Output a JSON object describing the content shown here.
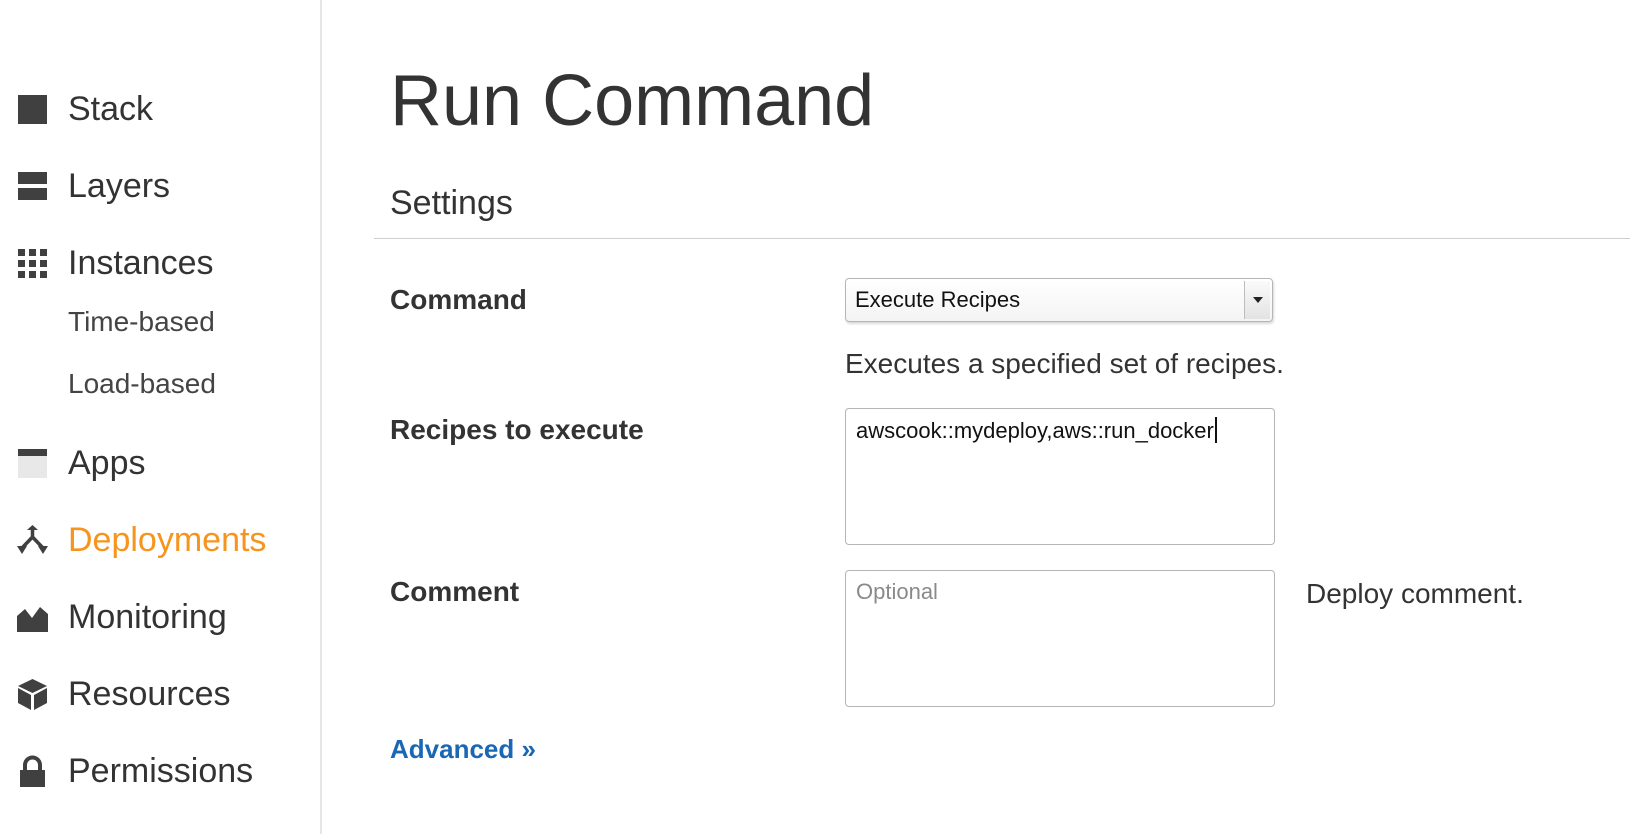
{
  "sidebar": {
    "items": [
      {
        "label": "Stack",
        "icon": "stack-icon"
      },
      {
        "label": "Layers",
        "icon": "layers-icon"
      },
      {
        "label": "Instances",
        "icon": "instances-icon"
      },
      {
        "label": "Apps",
        "icon": "apps-icon"
      },
      {
        "label": "Deployments",
        "icon": "deployments-icon",
        "active": true
      },
      {
        "label": "Monitoring",
        "icon": "monitoring-icon"
      },
      {
        "label": "Resources",
        "icon": "resources-icon"
      },
      {
        "label": "Permissions",
        "icon": "permissions-icon"
      }
    ],
    "sub_items": [
      {
        "label": "Time-based"
      },
      {
        "label": "Load-based"
      }
    ],
    "active_color": "#f7941d"
  },
  "main": {
    "title": "Run Command",
    "section_title": "Settings",
    "form": {
      "command": {
        "label": "Command",
        "selected": "Execute Recipes",
        "help": "Executes a specified set of recipes."
      },
      "recipes": {
        "label": "Recipes to execute",
        "value": "awscook::mydeploy,aws::run_docker"
      },
      "comment": {
        "label": "Comment",
        "placeholder": "Optional",
        "value": "",
        "help": "Deploy comment."
      }
    },
    "advanced_link": "Advanced »",
    "link_color": "#1a67b5"
  }
}
